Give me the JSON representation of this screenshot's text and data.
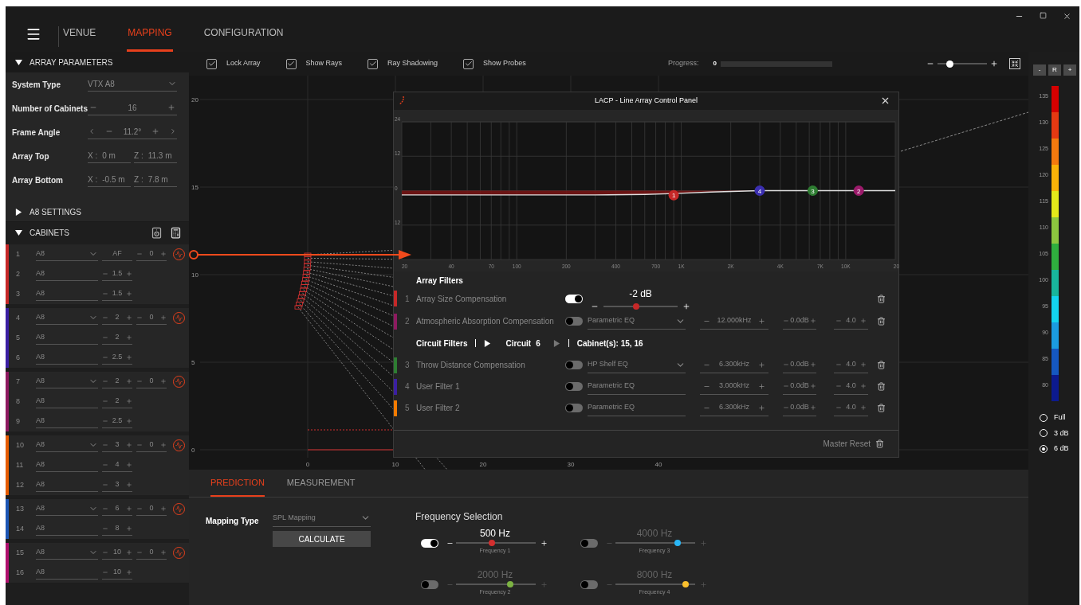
{
  "nav": {
    "tabs": [
      {
        "label": "VENUE",
        "selected": false
      },
      {
        "label": "MAPPING",
        "selected": true
      },
      {
        "label": "CONFIGURATION",
        "selected": false
      }
    ]
  },
  "left_panel": {
    "array_parameters": {
      "title": "ARRAY PARAMETERS",
      "expanded": true,
      "fields": [
        {
          "label": "System Type",
          "kind": "select",
          "value": "VTX A8"
        },
        {
          "label": "Number of Cabinets",
          "kind": "stepper",
          "value": "16"
        },
        {
          "label": "Frame Angle",
          "kind": "angle",
          "value": "11.2°"
        },
        {
          "label": "Array Top",
          "kind": "xz",
          "coords": [
            {
              "axis": "X :",
              "value": "0 m"
            },
            {
              "axis": "Z :",
              "value": "11.3 m"
            }
          ]
        },
        {
          "label": "Array Bottom",
          "kind": "xz",
          "coords": [
            {
              "axis": "X :",
              "value": "-0.5 m"
            },
            {
              "axis": "Z :",
              "value": "7.8 m"
            }
          ]
        }
      ]
    },
    "a8_settings": {
      "title": "A8 SETTINGS",
      "expanded": false
    },
    "cabinets": {
      "title": "CABINETS",
      "expanded": true,
      "groups": [
        {
          "color": "#c62828",
          "gain": "0",
          "rows": [
            {
              "number": "1",
              "type": "A8",
              "angle": {
                "kind": "fixed",
                "value": "AF"
              }
            },
            {
              "number": "2",
              "type": "A8",
              "angle": {
                "kind": "stepper",
                "value": "1.5"
              }
            },
            {
              "number": "3",
              "type": "A8",
              "angle": {
                "kind": "stepper",
                "value": "1.5"
              }
            }
          ]
        },
        {
          "color": "#3b1fa3",
          "gain": "0",
          "rows": [
            {
              "number": "4",
              "type": "A8",
              "angle": {
                "kind": "stepper",
                "value": "2"
              }
            },
            {
              "number": "5",
              "type": "A8",
              "angle": {
                "kind": "stepper",
                "value": "2"
              }
            },
            {
              "number": "6",
              "type": "A8",
              "angle": {
                "kind": "stepper",
                "value": "2.5"
              }
            }
          ]
        },
        {
          "color": "#8e1a60",
          "gain": "0",
          "rows": [
            {
              "number": "7",
              "type": "A8",
              "angle": {
                "kind": "stepper",
                "value": "2"
              }
            },
            {
              "number": "8",
              "type": "A8",
              "angle": {
                "kind": "stepper",
                "value": "2"
              }
            },
            {
              "number": "9",
              "type": "A8",
              "angle": {
                "kind": "stepper",
                "value": "2.5"
              }
            }
          ]
        },
        {
          "color": "#e65c00",
          "gain": "0",
          "rows": [
            {
              "number": "10",
              "type": "A8",
              "angle": {
                "kind": "stepper",
                "value": "3"
              }
            },
            {
              "number": "11",
              "type": "A8",
              "angle": {
                "kind": "stepper",
                "value": "4"
              }
            },
            {
              "number": "12",
              "type": "A8",
              "angle": {
                "kind": "stepper",
                "value": "3"
              }
            }
          ]
        },
        {
          "color": "#1c56b5",
          "gain": "0",
          "rows": [
            {
              "number": "13",
              "type": "A8",
              "angle": {
                "kind": "stepper",
                "value": "6"
              }
            },
            {
              "number": "14",
              "type": "A8",
              "angle": {
                "kind": "stepper",
                "value": "8"
              }
            }
          ]
        },
        {
          "color": "#b0106e",
          "gain": "0",
          "rows": [
            {
              "number": "15",
              "type": "A8",
              "angle": {
                "kind": "stepper",
                "value": "10"
              }
            },
            {
              "number": "16",
              "type": "A8",
              "angle": {
                "kind": "stepper",
                "value": "10"
              }
            }
          ]
        }
      ]
    }
  },
  "toolbar": {
    "checkboxes": [
      {
        "label": "Lock Array",
        "checked": true
      },
      {
        "label": "Show Rays",
        "checked": true
      },
      {
        "label": "Ray Shadowing",
        "checked": true
      },
      {
        "label": "Show Probes",
        "checked": true
      }
    ],
    "progress": {
      "label": "Progress:",
      "value": "0",
      "level": 0
    },
    "zoom": {
      "level": 0.25
    }
  },
  "plot": {
    "x_ticks": [
      "0",
      "10",
      "20",
      "30",
      "40"
    ],
    "y_ticks": [
      "20",
      "15",
      "10",
      "5",
      "0"
    ]
  },
  "lacp": {
    "title": "LACP - Line Array Control Panel",
    "graph": {
      "x_ticks": [
        "20",
        "40",
        "70",
        "100",
        "200",
        "400",
        "700",
        "1K",
        "2K",
        "4K",
        "7K",
        "10K",
        "20"
      ],
      "y_ticks": [
        "24",
        "12",
        "0",
        "12"
      ],
      "markers": [
        {
          "label": "1",
          "color": "#c62828"
        },
        {
          "label": "4",
          "color": "#3b2fb0"
        },
        {
          "label": "3",
          "color": "#2e7d32"
        },
        {
          "label": "2",
          "color": "#9c1b6b"
        }
      ]
    },
    "array_heading": "Array Filters",
    "array_filters": [
      {
        "number": "1",
        "name": "Array Size Compensation",
        "color": "#c62828",
        "on": true,
        "kind": "slider",
        "reading": "-2 dB",
        "level": 0.44
      },
      {
        "number": "2",
        "name": "Atmospheric Absorption Compensation",
        "color": "#8e1a60",
        "on": false,
        "kind": "eq",
        "type": "Parametric EQ",
        "dropdown": true,
        "frequency": "12.000kHz",
        "gain": "0.0dB",
        "q": "4.0"
      }
    ],
    "circuit": {
      "heading": "Circuit Filters",
      "label": "Circuit",
      "value": "6",
      "prev_enabled": true,
      "next_enabled": false,
      "cabinets": "Cabinet(s): 15, 16"
    },
    "circuit_filters": [
      {
        "number": "3",
        "name": "Throw Distance Compensation",
        "color": "#2e7d32",
        "on": false,
        "kind": "eq",
        "type": "HP Shelf EQ",
        "dropdown": true,
        "frequency": "6.300kHz",
        "gain": "0.0dB",
        "q": "4.0"
      },
      {
        "number": "4",
        "name": "User Filter 1",
        "color": "#3b1fa3",
        "on": false,
        "kind": "eq",
        "type": "Parametric EQ",
        "dropdown": false,
        "frequency": "3.000kHz",
        "gain": "0.0dB",
        "q": "4.0"
      },
      {
        "number": "5",
        "name": "User Filter 2",
        "color": "#f57c00",
        "on": false,
        "kind": "eq",
        "type": "Parametric EQ",
        "dropdown": false,
        "frequency": "6.300kHz",
        "gain": "0.0dB",
        "q": "4.0"
      }
    ],
    "master_reset": "Master Reset"
  },
  "legend": {
    "buttons": [
      "-",
      "R",
      "+"
    ],
    "scale": [
      {
        "label": "135",
        "color": "#d50000"
      },
      {
        "label": "130",
        "color": "#e53912"
      },
      {
        "label": "125",
        "color": "#f47a0e"
      },
      {
        "label": "120",
        "color": "#f9b208"
      },
      {
        "label": "115",
        "color": "#e3e81a"
      },
      {
        "label": "110",
        "color": "#8cc63f"
      },
      {
        "label": "105",
        "color": "#2fae3e"
      },
      {
        "label": "100",
        "color": "#18b59c"
      },
      {
        "label": "95",
        "color": "#13d3ee"
      },
      {
        "label": "90",
        "color": "#1b9be0"
      },
      {
        "label": "85",
        "color": "#1558c0"
      },
      {
        "label": "80",
        "color": "#0c1a8e"
      }
    ],
    "options": [
      {
        "label": "Full",
        "selected": false
      },
      {
        "label": "3 dB",
        "selected": false
      },
      {
        "label": "6 dB",
        "selected": true
      }
    ]
  },
  "bottom_panel": {
    "tabs": [
      {
        "label": "PREDICTION",
        "selected": true
      },
      {
        "label": "MEASUREMENT",
        "selected": false
      }
    ],
    "mapping_label": "Mapping Type",
    "mapping_value": "SPL Mapping",
    "calculate": "CALCULATE",
    "frequency": {
      "title": "Frequency Selection",
      "items": [
        {
          "value": "500 Hz",
          "label": "Frequency 1",
          "on": true,
          "level": 0.45,
          "color": "#d32f2f"
        },
        {
          "value": "4000 Hz",
          "label": "Frequency 3",
          "on": false,
          "level": 0.78,
          "color": "#29b6f6"
        },
        {
          "value": "2000 Hz",
          "label": "Frequency 2",
          "on": false,
          "level": 0.68,
          "color": "#7cb342"
        },
        {
          "value": "8000 Hz",
          "label": "Frequency 4",
          "on": false,
          "level": 0.88,
          "color": "#fbc02d"
        }
      ]
    }
  }
}
